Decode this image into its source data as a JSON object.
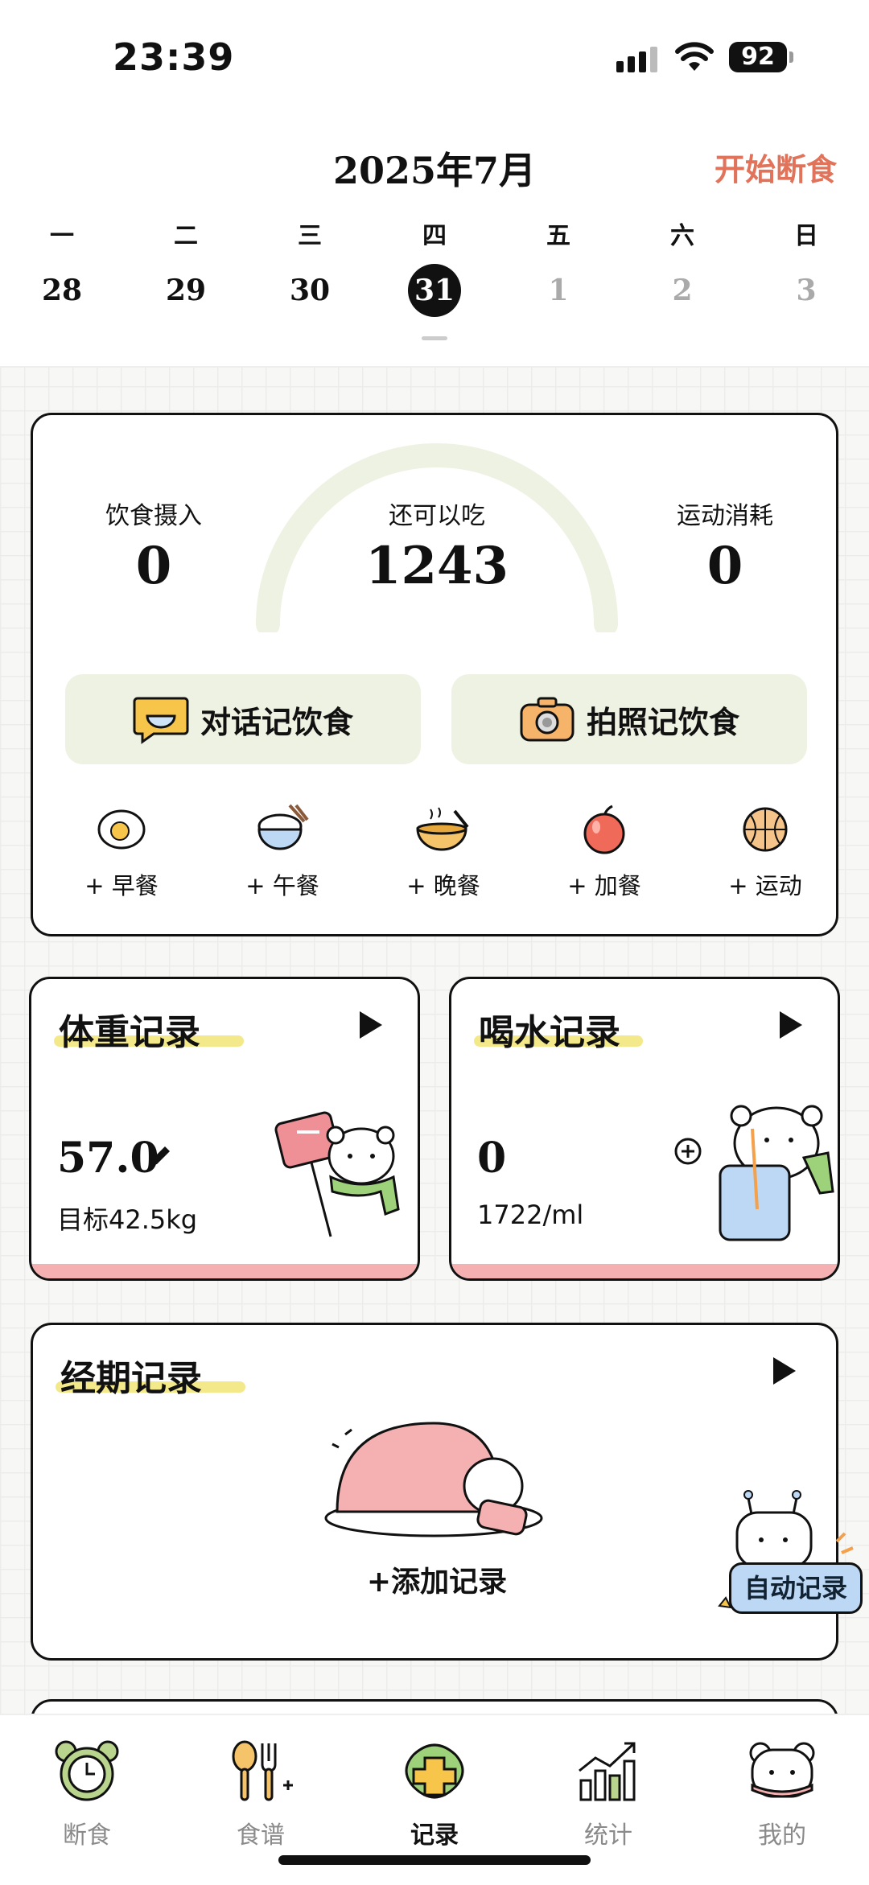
{
  "status_bar": {
    "time": "23:39",
    "battery": "92"
  },
  "calendar": {
    "month": "2025年7月",
    "start_fasting": "开始断食",
    "weekdays": [
      "一",
      "二",
      "三",
      "四",
      "五",
      "六",
      "日"
    ],
    "dates": [
      "28",
      "29",
      "30",
      "31",
      "1",
      "2",
      "3"
    ],
    "selected_index": 3
  },
  "summary": {
    "intake_label": "饮食摄入",
    "intake_value": "0",
    "remaining_label": "还可以吃",
    "remaining_value": "1243",
    "burn_label": "运动消耗",
    "burn_value": "0",
    "chat_log_button": "对话记饮食",
    "photo_log_button": "拍照记饮食",
    "meals": [
      "+ 早餐",
      "+ 午餐",
      "+ 晚餐",
      "+ 加餐",
      "+ 运动"
    ]
  },
  "weight_card": {
    "title": "体重记录",
    "value": "57.0",
    "target": "目标42.5kg"
  },
  "water_card": {
    "title": "喝水记录",
    "value": "0",
    "goal": "1722/ml"
  },
  "period_card": {
    "title": "经期记录",
    "add": "+添加记录"
  },
  "auto_record": "自动记录",
  "tabs": [
    "断食",
    "食谱",
    "记录",
    "统计",
    "我的"
  ],
  "active_tab": 2,
  "colors": {
    "accent": "#e0735a",
    "soft_green": "#eef2e2",
    "pink": "#f5b1b1",
    "highlight": "#f4e98a"
  },
  "icons": {
    "meals": [
      "egg-icon",
      "rice-bowl-icon",
      "soup-bowl-icon",
      "apple-icon",
      "basketball-icon"
    ],
    "tabs": [
      "alarm-clock-icon",
      "spoon-fork-icon",
      "plus-icon",
      "chart-icon",
      "bear-icon"
    ]
  }
}
